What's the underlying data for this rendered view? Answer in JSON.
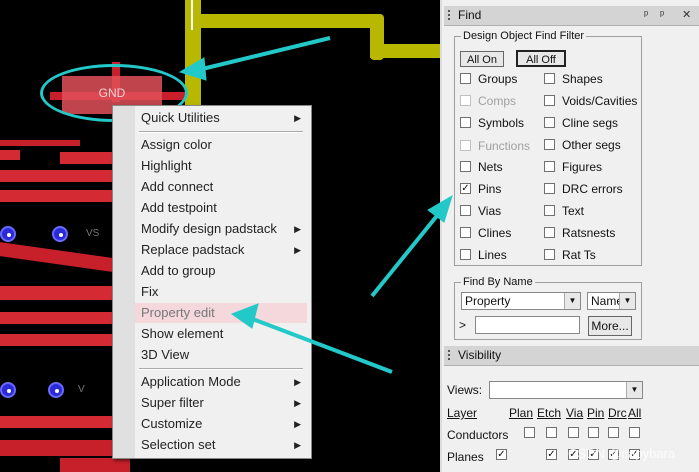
{
  "canvas": {
    "gnd_label": "GND",
    "pin_labels": [
      "VS",
      "V",
      "V"
    ]
  },
  "context_menu": {
    "items": [
      {
        "label": "Quick Utilities",
        "submenu": true
      },
      {
        "label": "Assign color",
        "submenu": false
      },
      {
        "label": "Highlight",
        "submenu": false
      },
      {
        "label": "Add connect",
        "submenu": false
      },
      {
        "label": "Add testpoint",
        "submenu": false
      },
      {
        "label": "Modify design padstack",
        "submenu": true
      },
      {
        "label": "Replace padstack",
        "submenu": true
      },
      {
        "label": "Add to group",
        "submenu": false
      },
      {
        "label": "Fix",
        "submenu": false
      },
      {
        "label": "Property edit",
        "submenu": false,
        "highlighted": true
      },
      {
        "label": "Show element",
        "submenu": false
      },
      {
        "label": "3D View",
        "submenu": false
      },
      {
        "label": "Application Mode",
        "submenu": true
      },
      {
        "label": "Super filter",
        "submenu": true
      },
      {
        "label": "Customize",
        "submenu": true
      },
      {
        "label": "Selection set",
        "submenu": true
      }
    ],
    "submenu_glyph": "▶"
  },
  "find_panel": {
    "title": "Find",
    "pin_glyph": "ᵖ",
    "close_glyph": "✕",
    "filter_group": "Design Object Find Filter",
    "all_on": "All On",
    "all_off": "All Off",
    "left_items": [
      {
        "label": "Groups",
        "checked": false,
        "disabled": false
      },
      {
        "label": "Comps",
        "checked": false,
        "disabled": true
      },
      {
        "label": "Symbols",
        "checked": false,
        "disabled": false
      },
      {
        "label": "Functions",
        "checked": false,
        "disabled": true
      },
      {
        "label": "Nets",
        "checked": false,
        "disabled": false
      },
      {
        "label": "Pins",
        "checked": true,
        "disabled": false
      },
      {
        "label": "Vias",
        "checked": false,
        "disabled": false
      },
      {
        "label": "Clines",
        "checked": false,
        "disabled": false
      },
      {
        "label": "Lines",
        "checked": false,
        "disabled": false
      }
    ],
    "right_items": [
      {
        "label": "Shapes",
        "checked": false,
        "disabled": false
      },
      {
        "label": "Voids/Cavities",
        "checked": false,
        "disabled": false
      },
      {
        "label": "Cline segs",
        "checked": false,
        "disabled": false
      },
      {
        "label": "Other segs",
        "checked": false,
        "disabled": false
      },
      {
        "label": "Figures",
        "checked": false,
        "disabled": false
      },
      {
        "label": "DRC errors",
        "checked": false,
        "disabled": false
      },
      {
        "label": "Text",
        "checked": false,
        "disabled": false
      },
      {
        "label": "Ratsnests",
        "checked": false,
        "disabled": false
      },
      {
        "label": "Rat Ts",
        "checked": false,
        "disabled": false
      }
    ],
    "find_by_name": {
      "group": "Find By Name",
      "type_value": "Property",
      "mode_value": "Name",
      "prompt": ">",
      "more_button": "More..."
    }
  },
  "visibility_panel": {
    "title": "Visibility",
    "views_label": "Views:",
    "views_value": "",
    "layer_header": "Layer",
    "columns": [
      "Plan",
      "Etch",
      "Via",
      "Pin",
      "Drc",
      "All"
    ],
    "rows": [
      {
        "label": "Conductors",
        "checks": [
          false,
          false,
          false,
          false,
          false,
          false
        ]
      },
      {
        "label": "Planes",
        "checks": [
          true,
          true,
          true,
          true,
          true,
          true
        ]
      }
    ]
  },
  "watermark": "CSDN @capybara",
  "colors": {
    "canvas_bg": "#000000",
    "trace": "#c8202a",
    "yellow_trace": "#b8b800",
    "annotation": "#23c9c9",
    "menu_highlight": "#f4d8dc"
  }
}
